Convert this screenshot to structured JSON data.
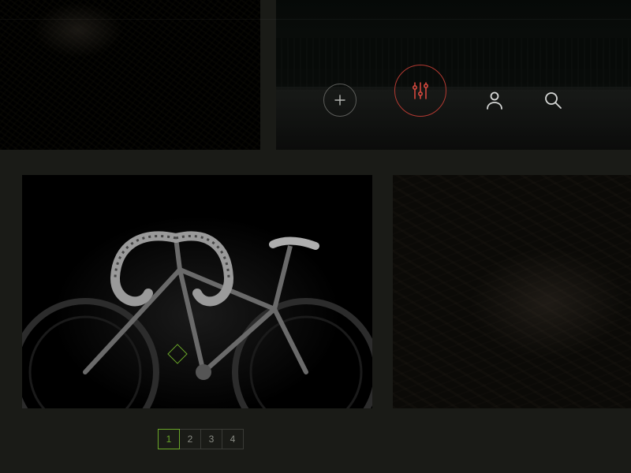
{
  "colors": {
    "accent_green": "#6aa728",
    "accent_red": "#b33a32",
    "icon_grey": "#d6d7d6",
    "border_grey": "#5c5d5a"
  },
  "toolbar": {
    "add_label": "+",
    "settings_label": "Settings",
    "profile_label": "Profile",
    "search_label": "Search"
  },
  "pagination": {
    "pages": [
      "1",
      "2",
      "3",
      "4"
    ],
    "active_index": 0
  }
}
